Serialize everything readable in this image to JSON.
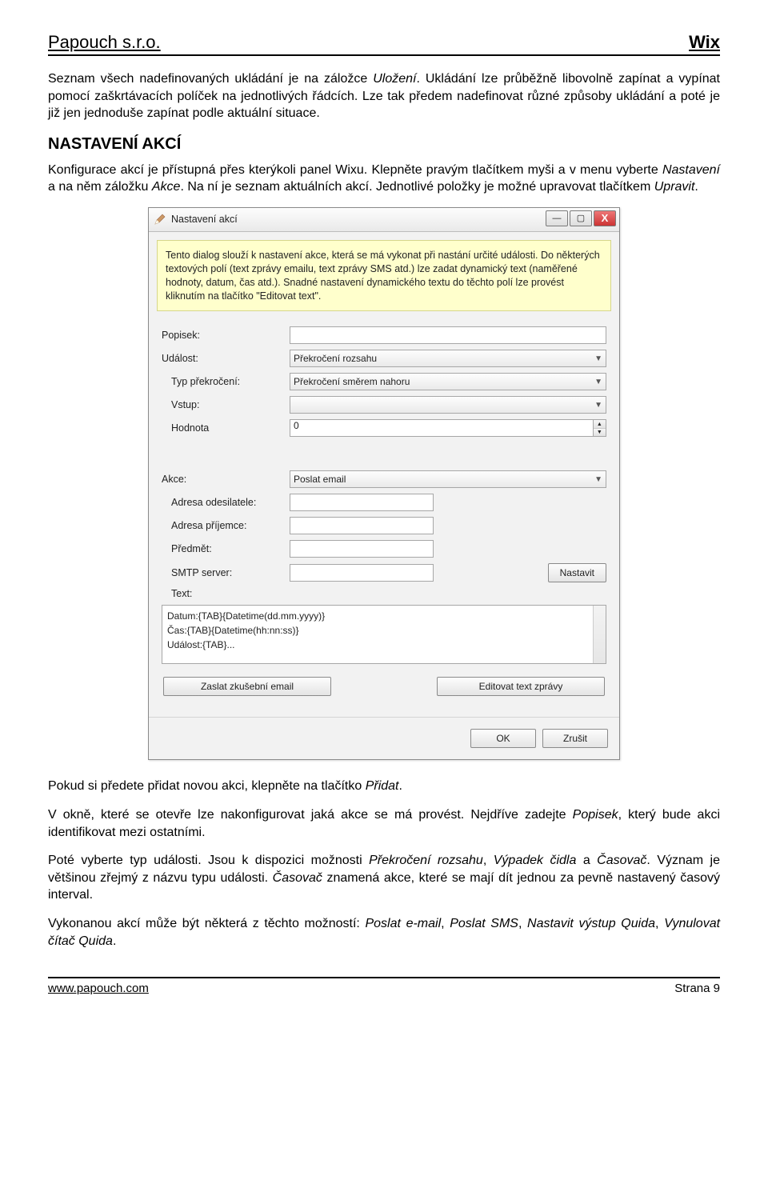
{
  "header": {
    "company": "Papouch s.r.o.",
    "product": "Wix"
  },
  "para1_a": "Seznam všech nadefinovaných ukládání je na záložce ",
  "para1_em": "Uložení",
  "para1_b": ". Ukládání lze průběžně libovolně zapínat a vypínat pomocí zaškrtávacích políček na jednotlivých řádcích. Lze tak předem nadefinovat různé způsoby ukládání a poté je již jen jednoduše zapínat podle aktuální situace.",
  "section": "NASTAVENÍ AKCÍ",
  "para2_a": "Konfigurace akcí je přístupná přes kterýkoli panel Wixu. Klepněte pravým tlačítkem myši a v menu vyberte ",
  "para2_em1": "Nastavení",
  "para2_b": " a na něm záložku ",
  "para2_em2": "Akce",
  "para2_c": ". Na ní je seznam aktuálních akcí. Jednotlivé položky je možné upravovat tlačítkem ",
  "para2_em3": "Upravit",
  "para2_d": ".",
  "dialog": {
    "title": "Nastavení akcí",
    "info": "Tento dialog slouží k nastavení akce, která se má vykonat při nastání určité události. Do některých textových polí (text zprávy emailu, text zprávy SMS atd.) lze zadat dynamický text (naměřené hodnoty, datum, čas atd.). Snadné nastavení dynamického textu do těchto polí lze provést kliknutím na tlačítko \"Editovat text\".",
    "labels": {
      "popisek": "Popisek:",
      "udalost": "Událost:",
      "typ": "Typ překročení:",
      "vstup": "Vstup:",
      "hodnota": "Hodnota",
      "akce": "Akce:",
      "odesilatel": "Adresa odesilatele:",
      "prijemce": "Adresa příjemce:",
      "predmet": "Předmět:",
      "smtp": "SMTP server:",
      "text": "Text:"
    },
    "values": {
      "udalost": "Překročení rozsahu",
      "typ": "Překročení směrem nahoru",
      "hodnota": "0",
      "akce": "Poslat email",
      "text_l1": "Datum:{TAB}{Datetime(dd.mm.yyyy)}",
      "text_l2": "Čas:{TAB}{Datetime(hh:nn:ss)}",
      "text_l3": "Událost:{TAB}..."
    },
    "buttons": {
      "nastavit": "Nastavit",
      "zaslat": "Zaslat zkušební email",
      "editovat": "Editovat text zprávy",
      "ok": "OK",
      "zrusit": "Zrušit"
    }
  },
  "para3_a": "Pokud si předete přidat novou akci, klepněte na tlačítko ",
  "para3_em": "Přidat",
  "para3_b": ".",
  "para4_a": "V okně, které se otevře lze nakonfigurovat jaká akce se má provést. Nejdříve zadejte ",
  "para4_em": "Popisek",
  "para4_b": ", který bude akci identifikovat mezi ostatními.",
  "para5_a": "Poté vyberte typ události. Jsou k dispozici možnosti ",
  "para5_em1": "Překročení rozsahu",
  "para5_b": ", ",
  "para5_em2": "Výpadek čidla",
  "para5_c": " a ",
  "para5_em3": "Časovač",
  "para5_d": ". Význam je většinou zřejmý z názvu typu události. ",
  "para5_em4": "Časovač",
  "para5_e": " znamená akce, které se mají dít jednou za pevně nastavený časový interval.",
  "para6_a": "Vykonanou akcí může být některá z těchto možností: ",
  "para6_em1": "Poslat e-mail",
  "para6_b": ", ",
  "para6_em2": "Poslat SMS",
  "para6_c": ", ",
  "para6_em3": "Nastavit výstup Quida",
  "para6_d": ", ",
  "para6_em4": "Vynulovat čítač Quida",
  "para6_e": ".",
  "footer": {
    "url": "www.papouch.com",
    "page": "Strana 9"
  }
}
